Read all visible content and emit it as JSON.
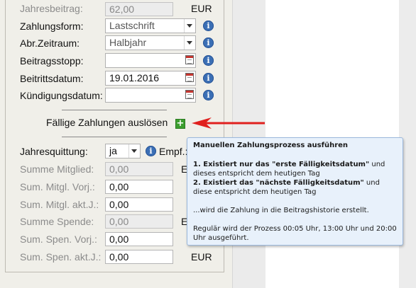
{
  "form": {
    "jahresbeitrag": {
      "label": "Jahresbeitrag:",
      "value": "62,00",
      "unit": "EUR"
    },
    "zahlungsform": {
      "label": "Zahlungsform:",
      "value": "Lastschrift"
    },
    "abr_zeitraum": {
      "label": "Abr.Zeitraum:",
      "value": "Halbjahr"
    },
    "beitragsstopp": {
      "label": "Beitragsstopp:",
      "value": ""
    },
    "beitrittsdatum": {
      "label": "Beitrittsdatum:",
      "value": "19.01.2016"
    },
    "kuendigungsdatum": {
      "label": "Kündigungsdatum:",
      "value": ""
    },
    "trigger_label": "Fällige Zahlungen auslösen",
    "jahresquittung": {
      "label": "Jahresquittung:",
      "value": "ja",
      "empf_label": "Empf.:"
    },
    "summe_mitglied": {
      "label": "Summe Mitglied:",
      "value": "0,00",
      "unit": "EU"
    },
    "sum_mitgl_vorj": {
      "label": "Sum. Mitgl. Vorj.:",
      "value": "0,00"
    },
    "sum_mitgl_aktj": {
      "label": "Sum. Mitgl. akt.J.:",
      "value": "0,00"
    },
    "summe_spende": {
      "label": "Summe Spende:",
      "value": "0,00",
      "unit": "EU"
    },
    "sum_spen_vorj": {
      "label": "Sum. Spen. Vorj.:",
      "value": "0,00"
    },
    "sum_spen_aktj": {
      "label": "Sum. Spen. akt.J.:",
      "value": "0,00",
      "unit": "EUR"
    }
  },
  "tooltip": {
    "title": "Manuellen Zahlungsprozess ausführen",
    "line1_bold": "1. Existiert nur das \"erste Fälligkeitsdatum\"",
    "line1_rest": " und dieses entspricht dem heutigen Tag",
    "line2_bold": "2. Existiert das \"nächste Fälligkeitsdatum\"",
    "line2_rest": " und diese entspricht dem heutigen Tag",
    "line3": "...wird die Zahlung in die Beitragshistorie erstellt.",
    "line4": "Regulär wird der Prozess 00:05 Uhr, 13:00 Uhr und 20:00 Uhr ausgeführt."
  },
  "icons": {
    "info": "i",
    "plus": "+"
  },
  "colors": {
    "arrow": "#e0201e",
    "plus": "#3c9e2f",
    "info": "#3b6fb5"
  }
}
